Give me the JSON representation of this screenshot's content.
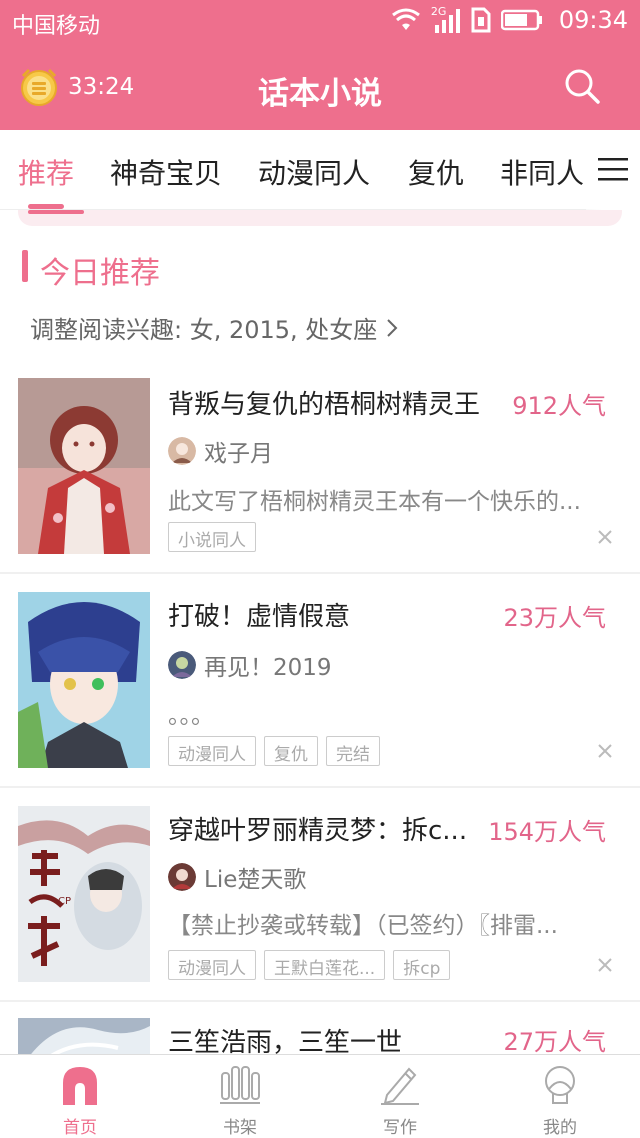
{
  "status_bar": {
    "carrier": "中国移动",
    "network": "2G",
    "time": "09:34",
    "icons": [
      "wifi-icon",
      "signal-icon",
      "sim-icon",
      "battery-icon"
    ]
  },
  "header": {
    "timer": "33:24",
    "title": "话本小说",
    "icons": [
      "alarm-clock-icon",
      "search-icon"
    ]
  },
  "tabs": {
    "items": [
      "推荐",
      "神奇宝贝",
      "动漫同人",
      "复仇",
      "非同人"
    ],
    "active": "推荐",
    "more_icon": "menu-icon"
  },
  "section": {
    "title": "今日推荐",
    "interest_text": "调整阅读兴趣: 女, 2015, 处女座"
  },
  "feed": [
    {
      "title": "背叛与复仇的梧桐树精灵王",
      "popularity": "912人气",
      "author": "戏子月",
      "description": "此文写了梧桐树精灵王本有一个快乐的...",
      "tags": [
        "小说同人"
      ]
    },
    {
      "title": "打破！虚情假意",
      "popularity": "23万人气",
      "author": "再见！2019",
      "description": "。。。",
      "tags": [
        "动漫同人",
        "复仇",
        "完结"
      ]
    },
    {
      "title": "穿越叶罗丽精灵梦：拆c...",
      "popularity": "154万人气",
      "author": "Lie楚天歌",
      "description": "【禁止抄袭或转载】（已签约）〖排雷...",
      "tags": [
        "动漫同人",
        "王默白莲花...",
        "拆cp"
      ]
    },
    {
      "title": "三笙浩雨，三笙一世",
      "popularity": "27万人气"
    }
  ],
  "bottom_nav": {
    "items": [
      {
        "label": "首页",
        "icon": "home-icon"
      },
      {
        "label": "书架",
        "icon": "bookshelf-icon"
      },
      {
        "label": "写作",
        "icon": "pen-icon"
      },
      {
        "label": "我的",
        "icon": "profile-icon"
      }
    ],
    "active": "首页"
  },
  "colors": {
    "accent": "#ee6f8d",
    "popularity": "#e2658a"
  }
}
